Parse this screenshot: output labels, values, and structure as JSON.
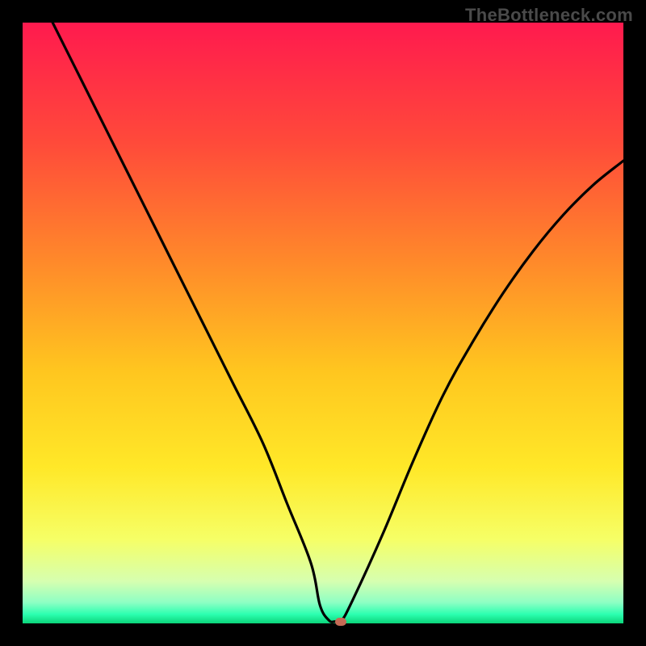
{
  "watermark": "TheBottleneck.com",
  "chart_data": {
    "type": "line",
    "title": "",
    "xlabel": "",
    "ylabel": "",
    "xlim": [
      0,
      100
    ],
    "ylim": [
      0,
      100
    ],
    "grid": false,
    "series": [
      {
        "name": "curve",
        "x": [
          5,
          10,
          15,
          20,
          25,
          30,
          35,
          40,
          44,
          48,
          49.5,
          51,
          52,
          53,
          55,
          60,
          65,
          70,
          75,
          80,
          85,
          90,
          95,
          100
        ],
        "y": [
          100,
          90,
          80,
          70,
          60,
          50,
          40,
          30,
          20,
          10,
          3,
          0.5,
          0.3,
          0.3,
          4,
          15,
          27,
          38,
          47,
          55,
          62,
          68,
          73,
          77
        ]
      }
    ],
    "marker": {
      "x": 53,
      "y": 0.3,
      "color": "#c46a55"
    },
    "gradient_stops": [
      {
        "offset": 0.0,
        "color": "#ff1a4e"
      },
      {
        "offset": 0.2,
        "color": "#ff4a3a"
      },
      {
        "offset": 0.4,
        "color": "#ff8a2a"
      },
      {
        "offset": 0.58,
        "color": "#ffc61f"
      },
      {
        "offset": 0.74,
        "color": "#ffe828"
      },
      {
        "offset": 0.86,
        "color": "#f6ff66"
      },
      {
        "offset": 0.93,
        "color": "#d6ffb0"
      },
      {
        "offset": 0.965,
        "color": "#8effc4"
      },
      {
        "offset": 0.985,
        "color": "#2bffb0"
      },
      {
        "offset": 1.0,
        "color": "#0bd47a"
      }
    ]
  }
}
